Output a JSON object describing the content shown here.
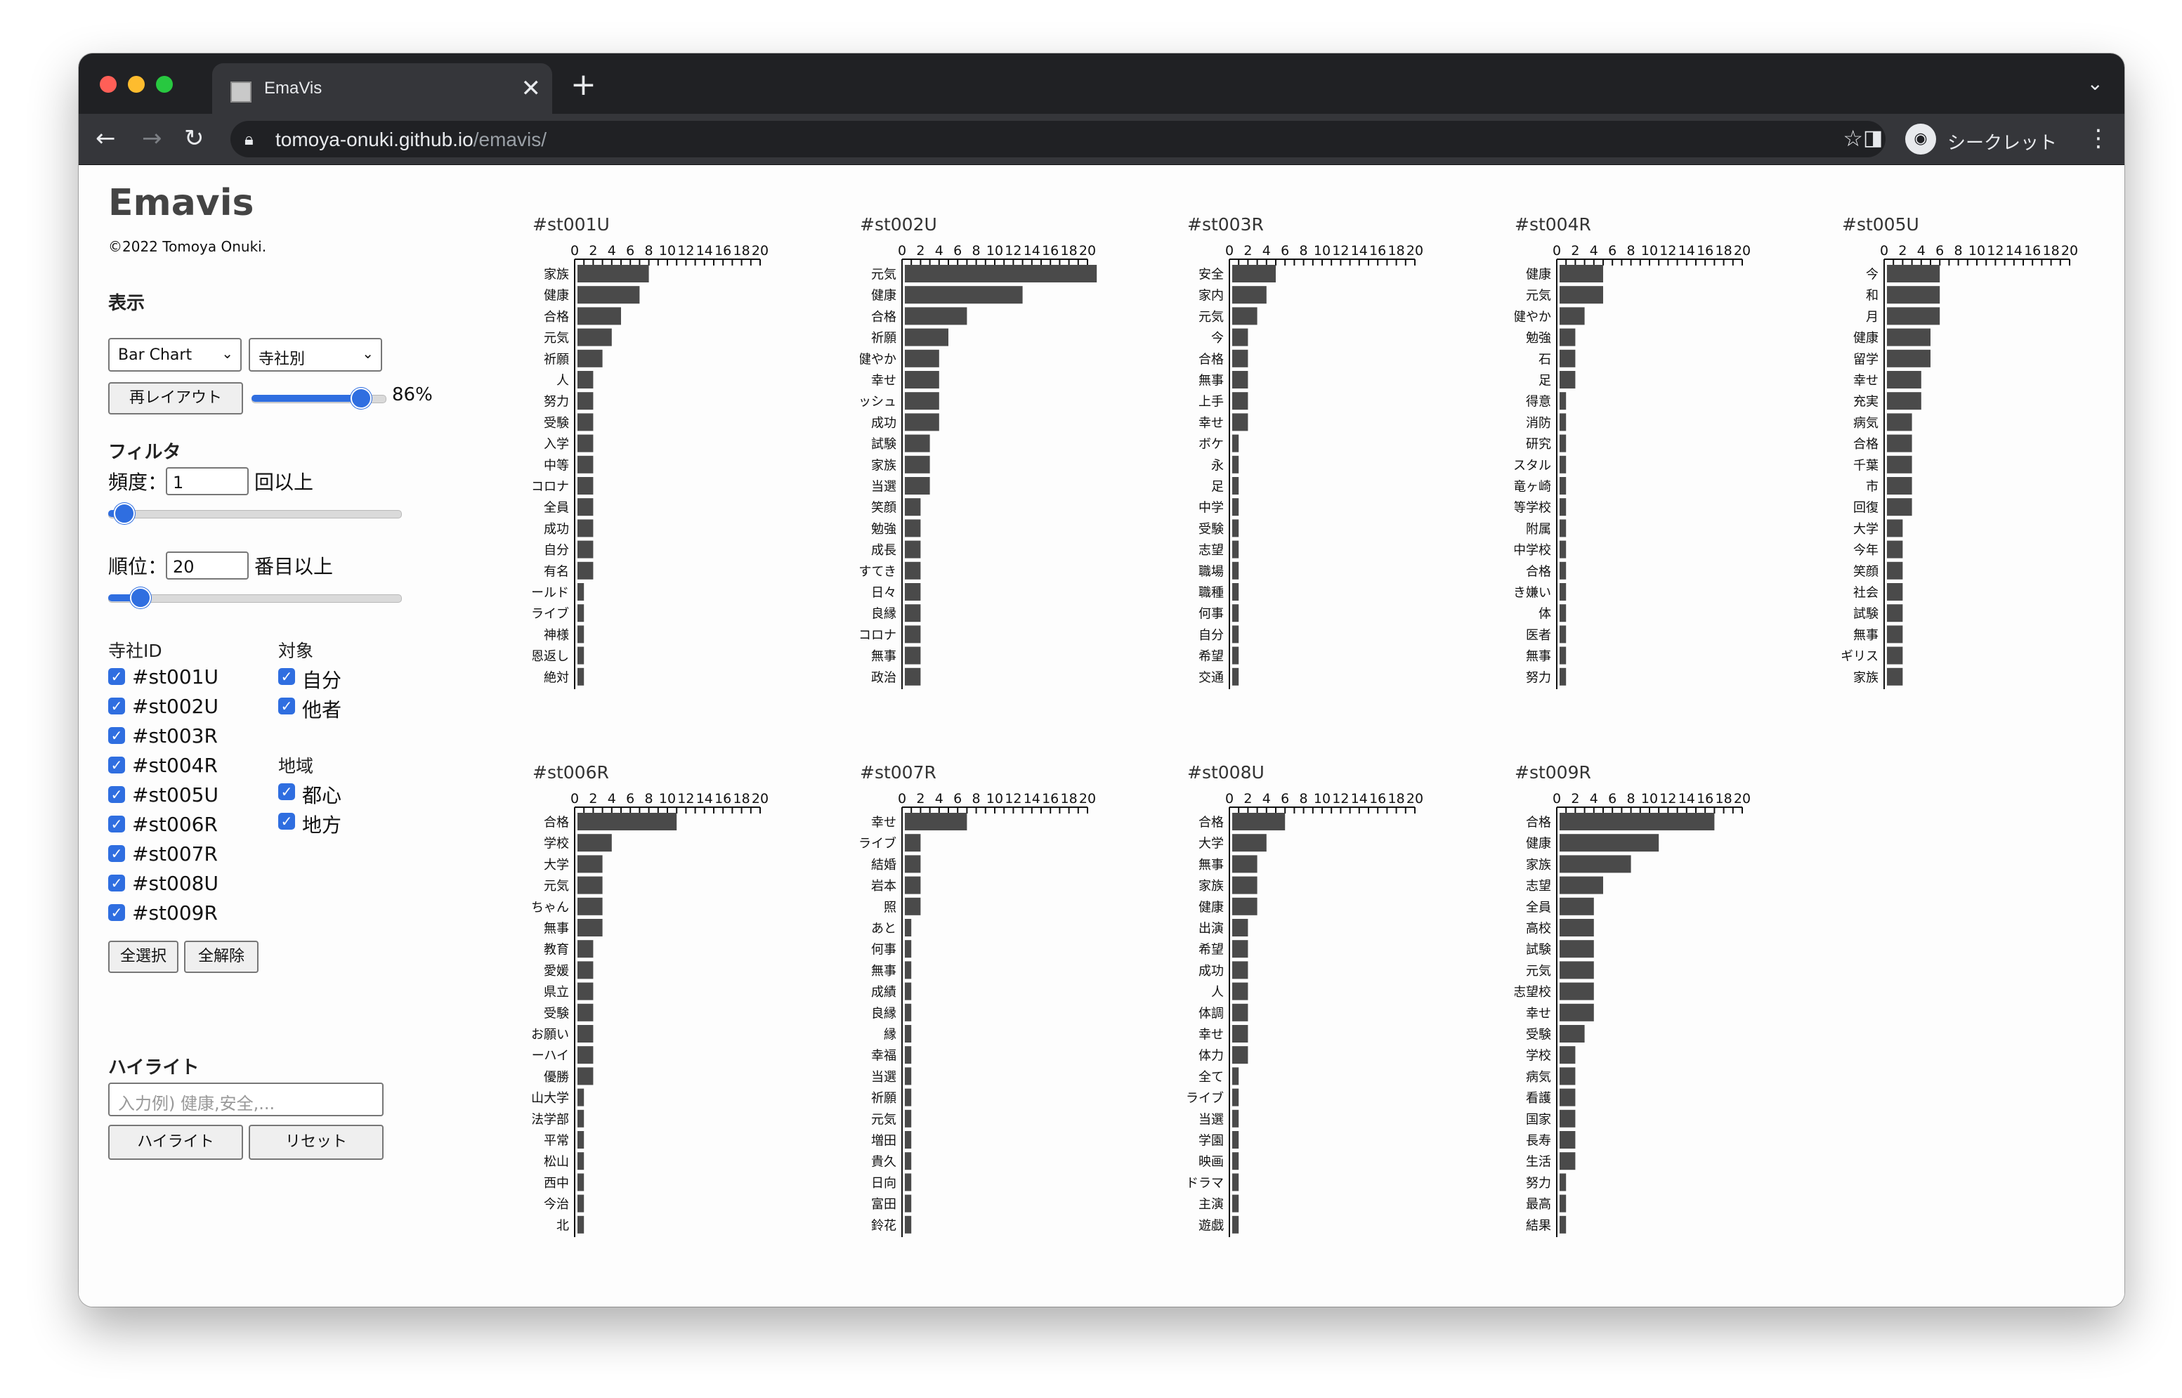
{
  "browser": {
    "tab_title": "EmaVis",
    "tab_close": "✕",
    "new_tab": "+",
    "url_host": "tomoya-onuki.github.io",
    "url_path": "/emavis/",
    "profile_label": "シークレット"
  },
  "app": {
    "title": "Emavis",
    "copyright": "©2022 Tomoya Onuki."
  },
  "display": {
    "heading": "表示",
    "chart_type": "Bar Chart",
    "group_mode": "寺社別",
    "relayout_button": "再レイアウト",
    "scale_percent": "86%",
    "scale_value": 0.86
  },
  "filter": {
    "heading": "フィルタ",
    "freq_label": "頻度：",
    "freq_value": "1",
    "freq_suffix": "回以上",
    "freq_slider": 0.02,
    "rank_label": "順位：",
    "rank_value": "20",
    "rank_suffix": "番目以上",
    "rank_slider": 0.08
  },
  "shrines": {
    "heading": "寺社ID",
    "items": [
      "#st001U",
      "#st002U",
      "#st003R",
      "#st004R",
      "#st005U",
      "#st006R",
      "#st007R",
      "#st008U",
      "#st009R"
    ],
    "select_all": "全選択",
    "deselect_all": "全解除"
  },
  "target": {
    "heading": "対象",
    "items": [
      "自分",
      "他者"
    ]
  },
  "region": {
    "heading": "地域",
    "items": [
      "都心",
      "地方"
    ]
  },
  "highlight": {
    "heading": "ハイライト",
    "placeholder": "入力例) 健康,安全,...",
    "apply_button": "ハイライト",
    "reset_button": "リセット"
  },
  "chart_data": [
    {
      "type": "bar",
      "title": "#st001U",
      "xlim": [
        0,
        20
      ],
      "ticks": [
        "0",
        "2",
        "4",
        "6",
        "8",
        "10",
        "12",
        "14",
        "16",
        "18",
        "20"
      ],
      "categories": [
        "家族",
        "健康",
        "合格",
        "元気",
        "祈願",
        "人",
        "努力",
        "受験",
        "入学",
        "中等",
        "コロナ",
        "全員",
        "成功",
        "自分",
        "有名",
        "ゴールド",
        "ライブ",
        "神様",
        "恩返し",
        "絶対"
      ],
      "values": [
        8,
        7,
        5,
        4,
        3,
        2,
        2,
        2,
        2,
        2,
        2,
        2,
        2,
        2,
        2,
        1,
        1,
        1,
        1,
        1
      ]
    },
    {
      "type": "bar",
      "title": "#st002U",
      "xlim": [
        0,
        20
      ],
      "ticks": [
        "0",
        "2",
        "4",
        "6",
        "8",
        "10",
        "12",
        "14",
        "16",
        "18",
        "20"
      ],
      "categories": [
        "元気",
        "健康",
        "合格",
        "祈願",
        "健やか",
        "幸せ",
        "フレッシュ",
        "成功",
        "試験",
        "家族",
        "当選",
        "笑顔",
        "勉強",
        "成長",
        "すてき",
        "日々",
        "良縁",
        "コロナ",
        "無事",
        "政治"
      ],
      "values": [
        21,
        13,
        7,
        5,
        4,
        4,
        4,
        4,
        3,
        3,
        3,
        2,
        2,
        2,
        2,
        2,
        2,
        2,
        2,
        2
      ]
    },
    {
      "type": "bar",
      "title": "#st003R",
      "xlim": [
        0,
        20
      ],
      "ticks": [
        "0",
        "2",
        "4",
        "6",
        "8",
        "10",
        "12",
        "14",
        "16",
        "18",
        "20"
      ],
      "categories": [
        "安全",
        "家内",
        "元気",
        "今",
        "合格",
        "無事",
        "上手",
        "幸せ",
        "ボケ",
        "永",
        "足",
        "中学",
        "受験",
        "志望",
        "職場",
        "職種",
        "何事",
        "自分",
        "希望",
        "交通"
      ],
      "values": [
        5,
        4,
        3,
        2,
        2,
        2,
        2,
        2,
        1,
        1,
        1,
        1,
        1,
        1,
        1,
        1,
        1,
        1,
        1,
        1
      ]
    },
    {
      "type": "bar",
      "title": "#st004R",
      "xlim": [
        0,
        20
      ],
      "ticks": [
        "0",
        "2",
        "4",
        "6",
        "8",
        "10",
        "12",
        "14",
        "16",
        "18",
        "20"
      ],
      "categories": [
        "健康",
        "元気",
        "健やか",
        "勉強",
        "石",
        "足",
        "得意",
        "消防",
        "研究",
        "クリスタル",
        "竜ヶ崎",
        "第一高等学校",
        "附属",
        "中学校",
        "合格",
        "好き嫌い",
        "体",
        "医者",
        "無事",
        "努力"
      ],
      "values": [
        5,
        5,
        3,
        2,
        2,
        2,
        1,
        1,
        1,
        1,
        1,
        1,
        1,
        1,
        1,
        1,
        1,
        1,
        1,
        1
      ]
    },
    {
      "type": "bar",
      "title": "#st005U",
      "xlim": [
        0,
        20
      ],
      "ticks": [
        "0",
        "2",
        "4",
        "6",
        "8",
        "10",
        "12",
        "14",
        "16",
        "18",
        "20"
      ],
      "categories": [
        "今",
        "和",
        "月",
        "健康",
        "留学",
        "幸せ",
        "充実",
        "病気",
        "合格",
        "千葉",
        "市",
        "回復",
        "大学",
        "今年",
        "笑顔",
        "社会",
        "試験",
        "無事",
        "イギリス",
        "家族"
      ],
      "values": [
        6,
        6,
        6,
        5,
        5,
        4,
        4,
        3,
        3,
        3,
        3,
        3,
        2,
        2,
        2,
        2,
        2,
        2,
        2,
        2
      ]
    },
    {
      "type": "bar",
      "title": "#st006R",
      "xlim": [
        0,
        20
      ],
      "ticks": [
        "0",
        "2",
        "4",
        "6",
        "8",
        "10",
        "12",
        "14",
        "16",
        "18",
        "20"
      ],
      "categories": [
        "合格",
        "学校",
        "大学",
        "元気",
        "赤ちゃん",
        "無事",
        "教育",
        "愛媛",
        "県立",
        "受験",
        "お願い",
        "インターハイ",
        "優勝",
        "松山大学",
        "法学部",
        "平常",
        "松山",
        "西中",
        "今治",
        "北"
      ],
      "values": [
        11,
        4,
        3,
        3,
        3,
        3,
        2,
        2,
        2,
        2,
        2,
        2,
        2,
        1,
        1,
        1,
        1,
        1,
        1,
        1
      ]
    },
    {
      "type": "bar",
      "title": "#st007R",
      "xlim": [
        0,
        20
      ],
      "ticks": [
        "0",
        "2",
        "4",
        "6",
        "8",
        "10",
        "12",
        "14",
        "16",
        "18",
        "20"
      ],
      "categories": [
        "幸せ",
        "ライブ",
        "結婚",
        "岩本",
        "照",
        "あと",
        "何事",
        "無事",
        "成績",
        "良縁",
        "縁",
        "幸福",
        "当選",
        "祈願",
        "元気",
        "増田",
        "貴久",
        "日向",
        "富田",
        "鈴花"
      ],
      "values": [
        7,
        2,
        2,
        2,
        2,
        1,
        1,
        1,
        1,
        1,
        1,
        1,
        1,
        1,
        1,
        1,
        1,
        1,
        1,
        1
      ]
    },
    {
      "type": "bar",
      "title": "#st008U",
      "xlim": [
        0,
        20
      ],
      "ticks": [
        "0",
        "2",
        "4",
        "6",
        "8",
        "10",
        "12",
        "14",
        "16",
        "18",
        "20"
      ],
      "categories": [
        "合格",
        "大学",
        "無事",
        "家族",
        "健康",
        "出演",
        "希望",
        "成功",
        "人",
        "体調",
        "幸せ",
        "体力",
        "全て",
        "ライブ",
        "当選",
        "学園",
        "映画",
        "ドラマ",
        "主演",
        "遊戯"
      ],
      "values": [
        6,
        4,
        3,
        3,
        3,
        2,
        2,
        2,
        2,
        2,
        2,
        2,
        1,
        1,
        1,
        1,
        1,
        1,
        1,
        1
      ]
    },
    {
      "type": "bar",
      "title": "#st009R",
      "xlim": [
        0,
        20
      ],
      "ticks": [
        "0",
        "2",
        "4",
        "6",
        "8",
        "10",
        "12",
        "14",
        "16",
        "18",
        "20"
      ],
      "categories": [
        "合格",
        "健康",
        "家族",
        "志望",
        "全員",
        "高校",
        "試験",
        "元気",
        "志望校",
        "幸せ",
        "受験",
        "学校",
        "病気",
        "看護",
        "国家",
        "長寿",
        "生活",
        "努力",
        "最高",
        "結果"
      ],
      "values": [
        17,
        11,
        8,
        5,
        4,
        4,
        4,
        4,
        4,
        4,
        3,
        2,
        2,
        2,
        2,
        2,
        2,
        1,
        1,
        1
      ]
    }
  ]
}
